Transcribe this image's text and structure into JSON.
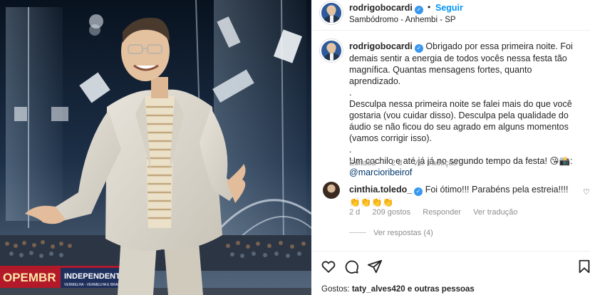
{
  "post": {
    "author": "rodrigobocardi",
    "follow_label": "Seguir",
    "separator": "•",
    "location": "Sambódromo - Anhembi - SP",
    "more_label": "···"
  },
  "caption": {
    "author": "rodrigobocardi",
    "lines": [
      "Obrigado por essa primeira noite. Foi demais sentir a energia de todos vocês nessa festa tão magnífica. Quantas mensagens fortes, quanto aprendizado.",
      ".",
      "Desculpa nessa primeira noite se falei mais do que você gostaria (vou cuidar disso). Desculpa pela qualidade do áudio se não ficou do seu agrado em alguns momentos (vamos corrigir isso).",
      ".",
      "Um cochilo e até já já no segundo tempo da festa! 😘📸:"
    ],
    "mention": "@marcioribeirof",
    "edited_label": "Editada",
    "time": "2 d",
    "translate_label": "Ver tradução"
  },
  "comment": {
    "author": "cinthia.toledo_",
    "text": "Foi ótimo!!! Parabéns pela estreia!!!! 👏👏👏👏",
    "time": "2 d",
    "likes_label": "209 gostos",
    "reply_label": "Responder",
    "translate_label": "Ver tradução",
    "view_replies_label": "Ver respostas (4)"
  },
  "footer": {
    "likes_prefix": "Gostos:",
    "likes_user": "taty_alves420",
    "likes_suffix": "e outras pessoas"
  },
  "icons": {
    "verified": "verified-badge-icon",
    "like": "heart-icon",
    "comment": "comment-icon",
    "share": "paper-plane-icon",
    "save": "bookmark-icon"
  },
  "photo_text": {
    "banner_left": "OPEMBR",
    "banner_right": "INDEPENDENTE",
    "banner_sub": "VERMELHA - VERMELHA E BRANCA"
  },
  "colors": {
    "accent": "#0095f6",
    "verified": "#3897f0",
    "muted": "#8e8e8e",
    "mention": "#00376b"
  }
}
